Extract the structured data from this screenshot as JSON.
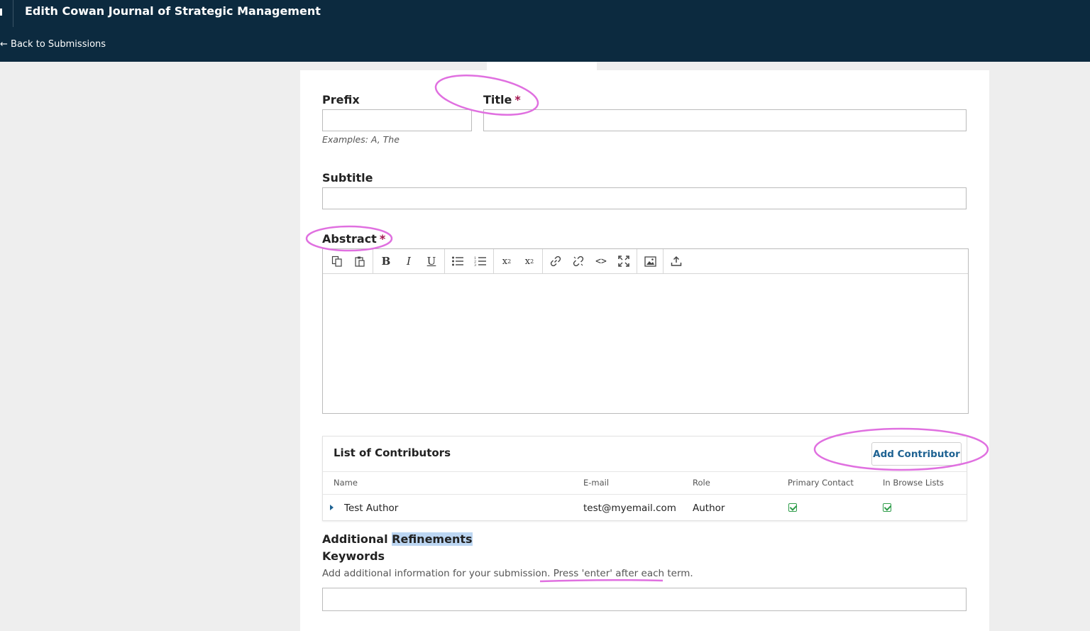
{
  "header": {
    "journal_title": "Edith Cowan Journal of Strategic Management",
    "back_link": "← Back to Submissions"
  },
  "form": {
    "prefix": {
      "label": "Prefix",
      "value": "",
      "hint": "Examples: A, The"
    },
    "title": {
      "label": "Title",
      "required_mark": "*",
      "value": ""
    },
    "subtitle": {
      "label": "Subtitle",
      "value": ""
    },
    "abstract": {
      "label": "Abstract",
      "required_mark": "*",
      "value": "",
      "toolbar": [
        [
          "copy-icon",
          "paste-icon"
        ],
        [
          "bold-icon",
          "italic-icon",
          "underline-icon"
        ],
        [
          "bullet-list-icon",
          "numbered-list-icon"
        ],
        [
          "superscript-icon",
          "subscript-icon"
        ],
        [
          "link-icon",
          "unlink-icon",
          "code-icon",
          "fullscreen-icon"
        ],
        [
          "image-icon"
        ],
        [
          "upload-icon"
        ]
      ]
    }
  },
  "contributors": {
    "heading": "List of Contributors",
    "add_button": "Add Contributor",
    "columns": [
      "Name",
      "E-mail",
      "Role",
      "Primary Contact",
      "In Browse Lists"
    ],
    "rows": [
      {
        "name": "Test Author",
        "email": "test@myemail.com",
        "role": "Author",
        "primary_contact": true,
        "in_browse_lists": true
      }
    ]
  },
  "refinements": {
    "title_plain": "Additional ",
    "title_highlight": "Refinements",
    "keywords_label": "Keywords",
    "keywords_desc_start": "Add additional information for your submission. ",
    "keywords_desc_emph": "Press 'enter' after each term.",
    "keywords_value": ""
  },
  "annotation_color": "#e070e0",
  "accent_color": "#1e6292",
  "header_color": "#0c2a3f"
}
